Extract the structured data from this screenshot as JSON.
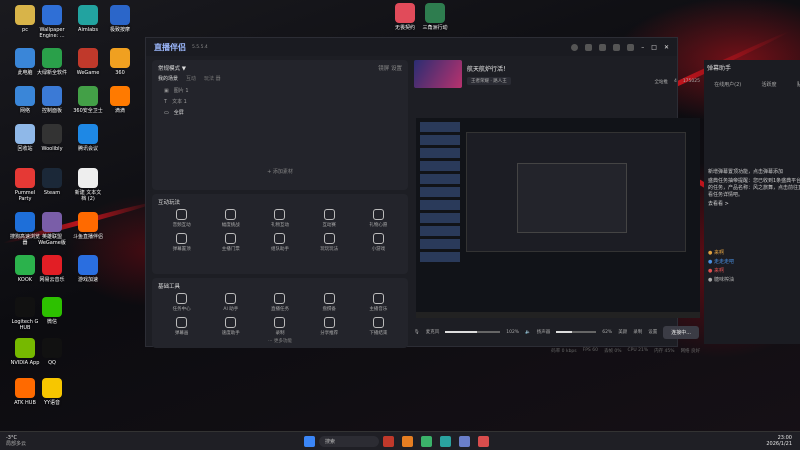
{
  "desktop_icons": [
    {
      "label": "pc",
      "color": "#d8b449"
    },
    {
      "label": "Wallpaper\nEngine: ...",
      "color": "#2f6fd6"
    },
    {
      "label": "Aimlabs",
      "color": "#22a3a0"
    },
    {
      "label": "极致按摩",
      "color": "#2b66c9"
    },
    {
      "label": "此电脑",
      "color": "#3a86d8"
    },
    {
      "label": "大绿新全软件",
      "color": "#2aa04a"
    },
    {
      "label": "WeGame",
      "color": "#c0392b"
    },
    {
      "label": "360",
      "color": "#f0a020"
    },
    {
      "label": "网络",
      "color": "#3a86d8"
    },
    {
      "label": "控制面板",
      "color": "#3b7ad6"
    },
    {
      "label": "360安全卫士",
      "color": "#43a047"
    },
    {
      "label": "滴滴",
      "color": "#ff7a00"
    },
    {
      "label": "回收站",
      "color": "#8fb8e8"
    },
    {
      "label": "Woolibly",
      "color": "#333"
    },
    {
      "label": "腾讯会议",
      "color": "#1e88e5"
    },
    {
      "label": "Pummel\nParty",
      "color": "#e53935"
    },
    {
      "label": "Steam",
      "color": "#1b2838"
    },
    {
      "label": "新建 文本文\n档 (2)",
      "color": "#eeeeee"
    },
    {
      "label": "搜狗高速浏览\n器",
      "color": "#1e6fd9"
    },
    {
      "label": "英雄联盟\nWeGame版",
      "color": "#7a5ea8"
    },
    {
      "label": "斗鱼直播伴侣",
      "color": "#ff6a00"
    },
    {
      "label": "KOOK",
      "color": "#2bb24c"
    },
    {
      "label": "网易云音乐",
      "color": "#e21e25"
    },
    {
      "label": "游戏加速",
      "color": "#2a6ee0"
    },
    {
      "label": "Logitech G\nHUB",
      "color": "#111"
    },
    {
      "label": "微信",
      "color": "#2dc100"
    },
    {
      "label": "NVIDIA App",
      "color": "#76b900"
    },
    {
      "label": "QQ",
      "color": "#111"
    },
    {
      "label": "ATK HUB",
      "color": "#ff6a00"
    },
    {
      "label": "YY语音",
      "color": "#f7c600"
    }
  ],
  "top_icons": [
    {
      "label": "无畏契约",
      "color": "#e14b5a"
    },
    {
      "label": "三角洲行动",
      "color": "#2e7d4f"
    }
  ],
  "app": {
    "name": "直播伴侣",
    "version": "5.5.5.4",
    "left": {
      "scene_mode": "常规模式 ▼",
      "scene_mode_right": [
        "镜屏",
        "设置"
      ],
      "tabs": [
        "我的场景",
        "互动",
        "玩法 器"
      ],
      "scenes": [
        "图片 1",
        "文本 1",
        "全屏"
      ],
      "add_material": "+ 添加素材",
      "interactive_title": "互动玩法",
      "interactive_items": [
        "音频互动",
        "幅度挑战",
        "礼物互动",
        "互动赛",
        "礼物心愿",
        "弹幕置顶",
        "主播门票",
        "组队助手",
        "玩玩玩法",
        "小游戏"
      ],
      "tools_title": "基础工具",
      "tools_items": [
        "任务中心",
        "AI 助手",
        "直播任务",
        "盘撰备",
        "主播音乐",
        "弹幕画",
        "速度助手",
        "录制",
        "分享推荐",
        "下播结束"
      ],
      "more": "··· 更多功能"
    },
    "center": {
      "stream_title": "航天航炉行活！",
      "tags": [
        "王者荣耀 · 路人王"
      ],
      "right_actions": [
        "全站推",
        "4",
        "175025"
      ],
      "controls": {
        "mic_label": "麦克风",
        "mic_pct": "102%",
        "mic_level": 0.58,
        "spk_label": "扬声器",
        "spk_pct": "62%",
        "spk_level": 0.4,
        "buttons": [
          "美颜",
          "录制",
          "设置"
        ],
        "start": "连接中..."
      },
      "status": [
        "码率 0 kbps",
        "FPS 60",
        "丢帧 0%",
        "CPU 21%",
        "内存 45%",
        "网络 良好"
      ]
    },
    "right": {
      "title": "弹幕助手",
      "tabs": [
        "在线用户(2)",
        "活跃度",
        "贴图"
      ],
      "msgs": [
        "新增弹幕置顶功能，点击弹幕添加",
        "盛典任务抽帝提醒：您已收到1条盛典平台推荐的任务，产品名称：风之旅舞，点击前往直播查看任务详情吧。",
        "去看看 >"
      ],
      "users": [
        {
          "name": "来啊",
          "color": "#e0a040"
        },
        {
          "name": "走走走吧",
          "color": "#4a90e2"
        },
        {
          "name": "来啊",
          "color": "#e05050"
        },
        {
          "name": "糖味榨油",
          "color": "#aaa"
        }
      ]
    }
  },
  "taskbar": {
    "weather": "-3°C",
    "weather_sub": "局部多云",
    "search": "搜索",
    "time": "23:00",
    "date": "2026/1/21"
  }
}
